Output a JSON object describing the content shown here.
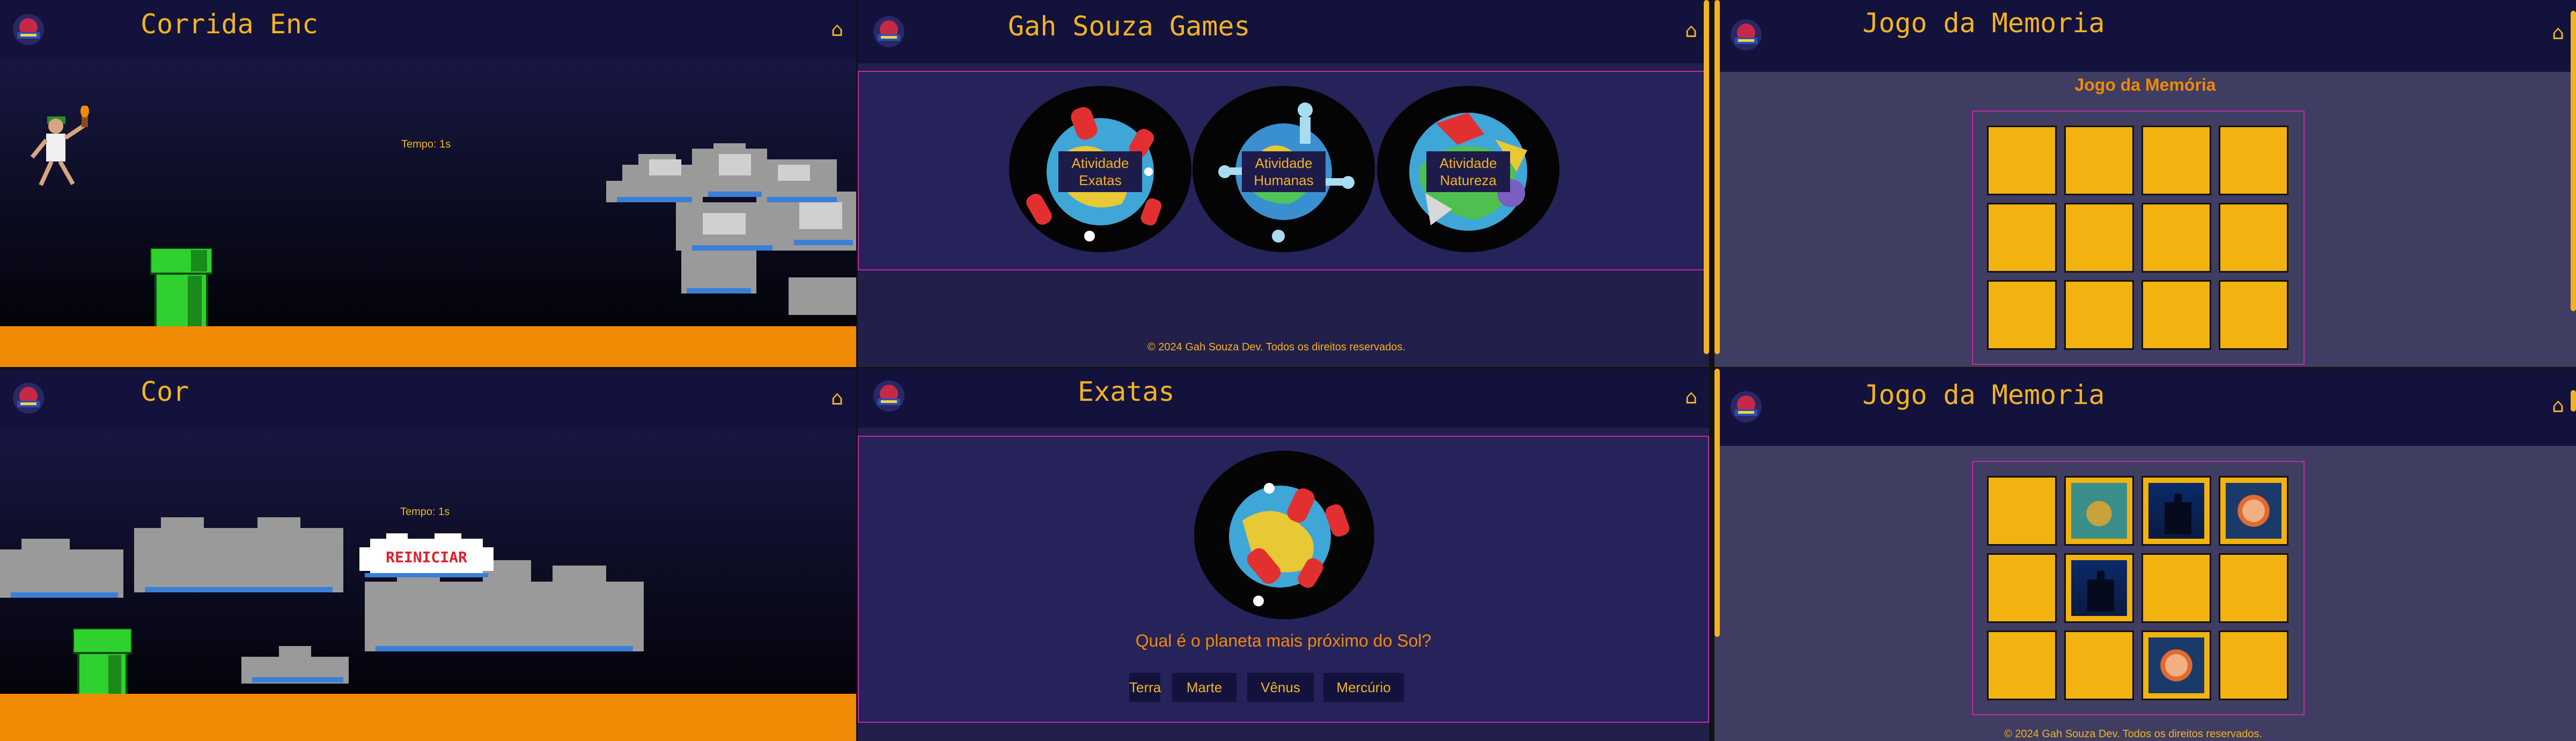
{
  "colors": {
    "accent": "#f3b320",
    "orange": "#f08a05",
    "header": "#12123c",
    "border": "#c02aa8",
    "ground": "#f08a05",
    "tile": "#f2b20f"
  },
  "icons": {
    "home": "⌂",
    "logo": "gah-souza-logo-icon"
  },
  "runner_top": {
    "title": "Corrida Enc",
    "timer": "Tempo: 1s"
  },
  "runner_bottom": {
    "title": "Cor",
    "timer": "Tempo: 1s",
    "restart_label": "REINICIAR"
  },
  "menu": {
    "title": "Gah Souza Games",
    "cards": [
      {
        "line1": "Atividade",
        "line2": "Exatas"
      },
      {
        "line1": "Atividade",
        "line2": "Humanas"
      },
      {
        "line1": "Atividade",
        "line2": "Natureza"
      }
    ],
    "footer": "© 2024 Gah Souza Dev. Todos os direitos reservados."
  },
  "quiz": {
    "title": "Exatas",
    "question": "Qual é o planeta mais próximo do Sol?",
    "answers": [
      "Terra",
      "Marte",
      "Vênus",
      "Mercúrio"
    ]
  },
  "memory_top": {
    "title": "Jogo da Memoria",
    "subtitle": "Jogo da Memória"
  },
  "memory_bottom": {
    "title": "Jogo da Memoria",
    "footer": "© 2024 Gah Souza Dev. Todos os direitos reservados.",
    "revealed": [
      "",
      "turtle-image",
      "castle-image",
      "fish-image",
      "",
      "castle-image",
      "",
      "",
      "",
      "",
      "fish-image",
      ""
    ]
  }
}
